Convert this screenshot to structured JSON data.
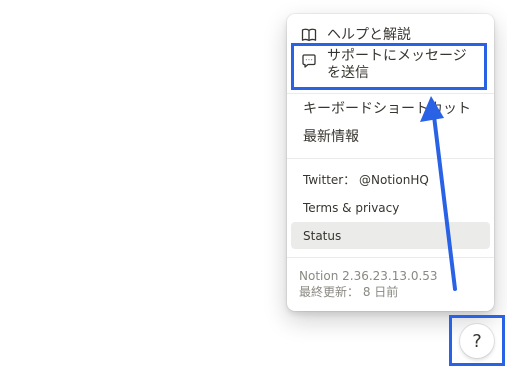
{
  "menu": {
    "help_label": "ヘルプと解説",
    "contact_label": "サポートにメッセージを送信",
    "shortcuts_label": "キーボードショートカット",
    "whats_new_label": "最新情報",
    "twitter_label": "Twitter： @NotionHQ",
    "terms_label": "Terms & privacy",
    "status_label": "Status",
    "version": "Notion 2.36.23.13.0.53",
    "last_updated": "最終更新： 8 日前"
  },
  "help_button": {
    "label": "?"
  },
  "colors": {
    "annotation": "#2a62e6",
    "text": "#37352f",
    "muted_text": "#8a8882",
    "hover_bg": "#ebebea"
  },
  "icons": {
    "help": "book-icon",
    "contact": "chat-bubble-icon"
  }
}
